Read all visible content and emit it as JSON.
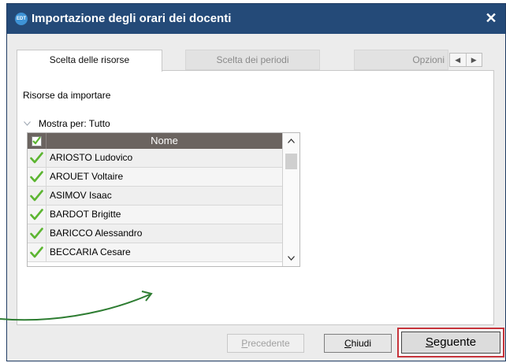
{
  "window": {
    "app_icon_text": "EDT",
    "title": "Importazione degli orari dei docenti",
    "close_symbol": "✕"
  },
  "tabs": [
    {
      "label": "Scelta delle risorse",
      "active": true
    },
    {
      "label": "Scelta dei periodi",
      "active": false
    },
    {
      "label": "Opzioni",
      "active": false
    }
  ],
  "tab_scroll": {
    "left": "◀",
    "right": "▶"
  },
  "panel": {
    "resources_label": "Risorse da importare",
    "filter_label": "Mostra per: Tutto"
  },
  "table": {
    "column_header": "Nome",
    "header_checked": true,
    "rows": [
      {
        "name": "ARIOSTO Ludovico",
        "checked": true
      },
      {
        "name": "AROUET Voltaire",
        "checked": true
      },
      {
        "name": "ASIMOV Isaac",
        "checked": true
      },
      {
        "name": "BARDOT Brigitte",
        "checked": true
      },
      {
        "name": "BARICCO Alessandro",
        "checked": true
      },
      {
        "name": "BECCARIA Cesare",
        "checked": true
      }
    ]
  },
  "buttons": {
    "previous": "Precedente",
    "close": "Chiudi",
    "next": "Seguente"
  },
  "colors": {
    "titlebar": "#244a78",
    "header": "#6b6460",
    "check": "#5cb531",
    "highlight": "#c6343b",
    "annotation_arrow": "#2e7d32"
  }
}
